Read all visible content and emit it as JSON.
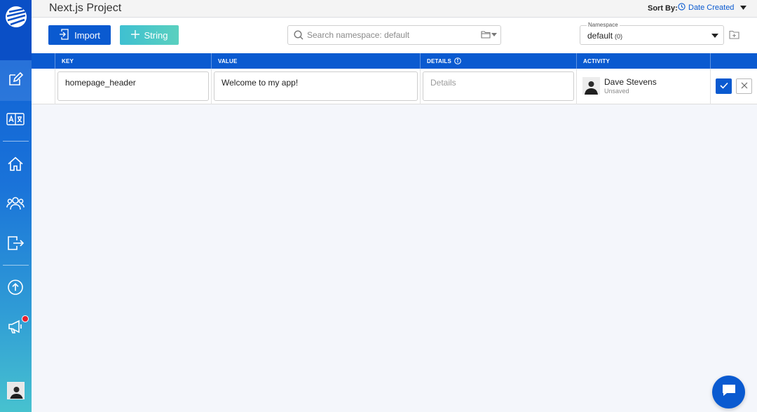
{
  "header": {
    "title": "Next.js Project",
    "sort_label": "Sort By:",
    "sort_value": "Date Created"
  },
  "toolbar": {
    "import_label": "Import",
    "string_label": "String",
    "search_placeholder": "Search namespace: default",
    "namespace_label": "Namespace",
    "namespace_value": "default",
    "namespace_count": "(0)"
  },
  "table": {
    "columns": [
      "KEY",
      "VALUE",
      "DETAILS",
      "ACTIVITY"
    ],
    "rows": [
      {
        "key": "homepage_header",
        "value": "Welcome to my app!",
        "details_placeholder": "Details",
        "user": "Dave Stevens",
        "status": "Unsaved"
      }
    ]
  },
  "icons": {
    "sidebar": [
      "logo-icon",
      "edit-icon",
      "translate-icon",
      "home-icon",
      "users-icon",
      "export-icon",
      "upload-icon",
      "megaphone-icon",
      "user-avatar"
    ],
    "toolbar": [
      "import-icon",
      "plus-icon",
      "search-icon",
      "folder-icon",
      "add-folder-icon"
    ],
    "row": [
      "check-icon",
      "close-icon"
    ],
    "other": [
      "clock-icon",
      "info-icon",
      "chat-icon"
    ]
  },
  "colors": {
    "primary": "#0a5ad0",
    "accent_teal": "#47c2cf",
    "notification": "#e8202f"
  }
}
